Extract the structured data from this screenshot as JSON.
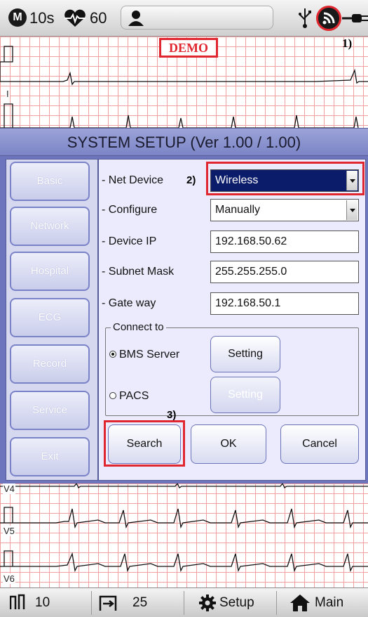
{
  "status_bar": {
    "mode_letter": "M",
    "speed": "10s",
    "heart_rate": "60",
    "icons": [
      "mode-icon",
      "heart-icon",
      "patient-icon",
      "usb-icon",
      "wifi-icon",
      "power-plug-icon"
    ]
  },
  "ecg": {
    "demo_label": "DEMO",
    "top_lead": "I",
    "bottom_leads": [
      "V4",
      "V5",
      "V6"
    ]
  },
  "callouts": {
    "one": "1)",
    "two": "2)",
    "three": "3)"
  },
  "dialog": {
    "title": "SYSTEM SETUP (Ver 1.00 / 1.00)",
    "side_menu": [
      {
        "label": "Basic"
      },
      {
        "label": "Network"
      },
      {
        "label": "Hospital"
      },
      {
        "label": "ECG"
      },
      {
        "label": "Record"
      },
      {
        "label": "Service"
      },
      {
        "label": "Exit"
      }
    ],
    "fields": {
      "net_device": {
        "label": "- Net Device",
        "value": "Wireless"
      },
      "configure": {
        "label": "- Configure",
        "value": "Manually"
      },
      "device_ip": {
        "label": "- Device IP",
        "value": "192.168.50.62"
      },
      "subnet_mask": {
        "label": "- Subnet Mask",
        "value": "255.255.255.0"
      },
      "gateway": {
        "label": "- Gate way",
        "value": "192.168.50.1"
      }
    },
    "connect_to": {
      "legend": "Connect to",
      "options": [
        {
          "label": "BMS Server",
          "selected": true,
          "setting_label": "Setting"
        },
        {
          "label": "PACS",
          "selected": false,
          "setting_label": "Setting"
        }
      ]
    },
    "buttons": {
      "search": "Search",
      "ok": "OK",
      "cancel": "Cancel"
    }
  },
  "toolbar": {
    "gain": "10",
    "speed": "25",
    "setup": "Setup",
    "main": "Main"
  },
  "colors": {
    "highlight_red": "#e0262e",
    "dialog_blue": "#7c85c6",
    "selected_navy": "#0b1c6b",
    "grid_pink": "#f0a0a0"
  }
}
